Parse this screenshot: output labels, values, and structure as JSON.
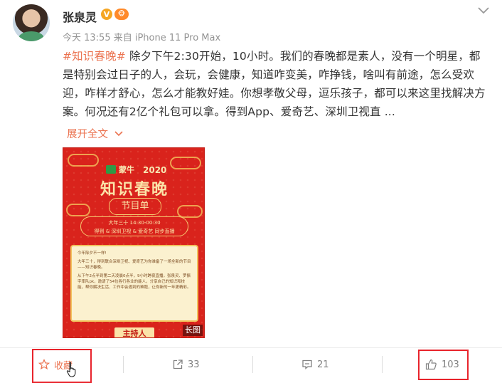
{
  "post": {
    "author": "张泉灵",
    "verified_badge": "V",
    "level_badge": "🐵",
    "meta": "今天 13:55 来自 iPhone 11 Pro Max",
    "topic": "#知识春晚#",
    "text": "除夕下午2:30开始，10小时。我们的春晚都是素人，没有一个明星，都是特别会过日子的人，会玩，会健康，知道咋变美，咋挣钱，啥叫有前途，怎么受欢迎，咋样才舒心，怎么才能教好娃。你想孝敬父母，逗乐孩子，都可以来这里找解决方案。何况还有2亿个礼包可以拿。得到App、爱奇艺、深圳卫视直 ...",
    "expand_label": "展开全文",
    "icons": {
      "more": "chevron-down-icon",
      "expand": "chevron-down-icon"
    }
  },
  "poster": {
    "brand": "蒙牛",
    "year": "2020",
    "title": "知识春晚",
    "subtitle": "节目单",
    "band_line1": "大年三十 14:30-00:30",
    "band_line2": "得到 & 深圳卫视 & 爱奇艺 同步直播",
    "card_p1": "今年除夕不一样!",
    "card_p2": "大年三十，得到联合深圳卫视、爱奇艺为你准备了一场全新的节目——知识春晚。",
    "card_p3": "从下午2点半到第二天凌晨0点半，9小时跨夜直播，张泉灵、罗振宇率队pk，邀请了54位各行各业的能人，分享自己的知识和技能，帮你解决生活、工作中会遇到的难题，让你新的一年更精彩。",
    "host_label": "主持人",
    "long_tag": "长图"
  },
  "actions": {
    "favorite_label": "收藏",
    "repost_count": "33",
    "comment_count": "21",
    "like_count": "103"
  },
  "colors": {
    "accent": "#eb7350",
    "highlight": "#e8242c",
    "poster_red": "#d9231c"
  }
}
